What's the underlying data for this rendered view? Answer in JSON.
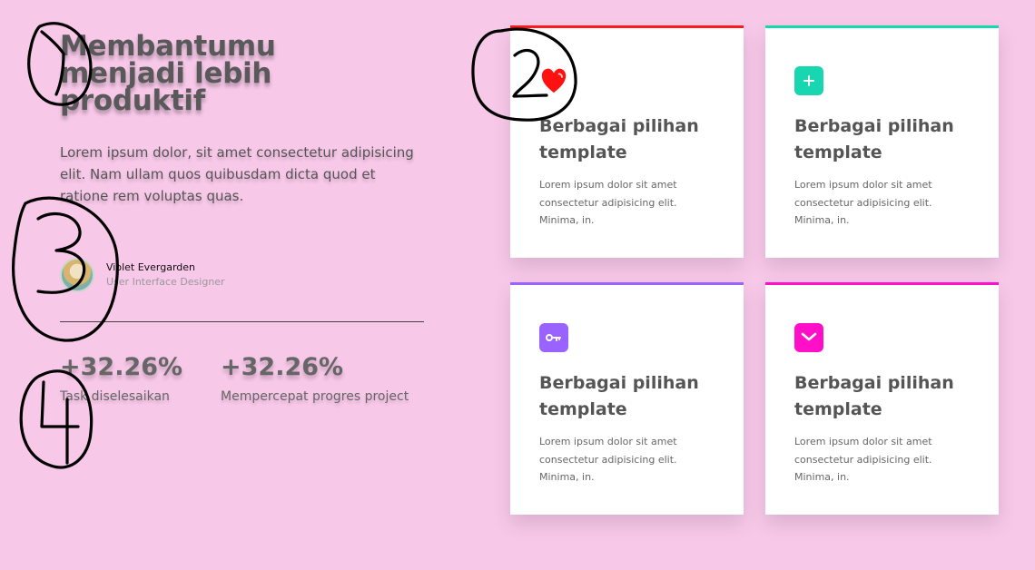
{
  "hero": {
    "title": "Membantumu menjadi lebih produktif",
    "description": "Lorem ipsum dolor, sit amet consectetur adipisicing elit. Nam ullam quos quibusdam dicta quod et ratione rem voluptas quas."
  },
  "author": {
    "name": "Violet Evergarden",
    "role": "User Interface Designer"
  },
  "stats": [
    {
      "value": "+32.26%",
      "label": "Task diselesaikan"
    },
    {
      "value": "+32.26%",
      "label": "Mempercepat  progres project"
    }
  ],
  "cards": [
    {
      "title": "Berbagai pilihan template",
      "text": "Lorem ipsum dolor sit amet consectetur adipisicing elit. Minima, in.",
      "icon": "heart-icon",
      "accent": "#ff1b1b"
    },
    {
      "title": "Berbagai pilihan template",
      "text": "Lorem ipsum dolor sit amet consectetur adipisicing elit. Minima, in.",
      "icon": "plus-icon",
      "accent": "#18d6b0"
    },
    {
      "title": "Berbagai pilihan template",
      "text": "Lorem ipsum dolor sit amet consectetur adipisicing elit. Minima, in.",
      "icon": "key-icon",
      "accent": "#9a62ff"
    },
    {
      "title": "Berbagai pilihan template",
      "text": "Lorem ipsum dolor sit amet consectetur adipisicing elit. Minima, in."
    }
  ],
  "colors": {
    "background": "#f8c8e9",
    "card": "#ffffff",
    "annotation": "#000000",
    "heart": "#ff1111"
  },
  "annotations": [
    {
      "label": "1",
      "icon": "circled-number-icon"
    },
    {
      "label": "2",
      "icon": "circled-number-icon"
    },
    {
      "label": "3",
      "icon": "circled-number-icon"
    },
    {
      "label": "4",
      "icon": "circled-number-icon"
    }
  ]
}
